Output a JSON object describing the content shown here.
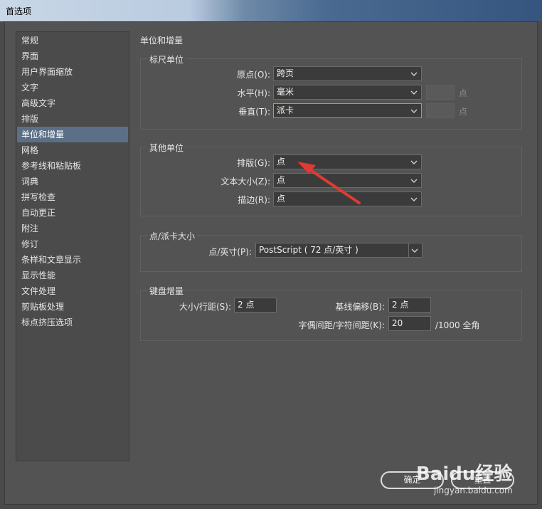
{
  "window": {
    "title": "首选项"
  },
  "sidebar": {
    "items": [
      {
        "label": "常规"
      },
      {
        "label": "界面"
      },
      {
        "label": "用户界面缩放"
      },
      {
        "label": "文字"
      },
      {
        "label": "高级文字"
      },
      {
        "label": "排版"
      },
      {
        "label": "单位和增量"
      },
      {
        "label": "网格"
      },
      {
        "label": "参考线和粘贴板"
      },
      {
        "label": "词典"
      },
      {
        "label": "拼写检查"
      },
      {
        "label": "自动更正"
      },
      {
        "label": "附注"
      },
      {
        "label": "修订"
      },
      {
        "label": "条样和文章显示"
      },
      {
        "label": "显示性能"
      },
      {
        "label": "文件处理"
      },
      {
        "label": "剪贴板处理"
      },
      {
        "label": "标点挤压选项"
      }
    ],
    "selected": "单位和增量"
  },
  "panel": {
    "title": "单位和增量",
    "ruler_units": {
      "legend": "标尺单位",
      "origin": {
        "label": "原点(O):",
        "value": "跨页"
      },
      "horizontal": {
        "label": "水平(H):",
        "value": "毫米",
        "unit": "点"
      },
      "vertical": {
        "label": "垂直(T):",
        "value": "派卡",
        "unit": "点"
      }
    },
    "other_units": {
      "legend": "其他单位",
      "composition": {
        "label": "排版(G):",
        "value": "点"
      },
      "text_size": {
        "label": "文本大小(Z):",
        "value": "点"
      },
      "stroke": {
        "label": "描边(R):",
        "value": "点"
      }
    },
    "point_pica": {
      "legend": "点/派卡大小",
      "points_per_inch": {
        "label": "点/英寸(P):",
        "value": "PostScript ( 72 点/英寸 )"
      }
    },
    "keyboard": {
      "legend": "键盘增量",
      "size_leading": {
        "label": "大小/行距(S):",
        "value": "2 点"
      },
      "baseline_shift": {
        "label": "基线偏移(B):",
        "value": "2 点"
      },
      "kerning_tracking": {
        "label": "字偶间距/字符间距(K):",
        "value": "20",
        "suffix": "/1000 全角"
      }
    }
  },
  "buttons": {
    "ok": "确定",
    "reset": "重置"
  },
  "watermark": {
    "brand": "Baidu经验",
    "url": "jingyan.baidu.com"
  },
  "colors": {
    "annotation_arrow": "#e03a34",
    "selection": "#5b6f86"
  }
}
